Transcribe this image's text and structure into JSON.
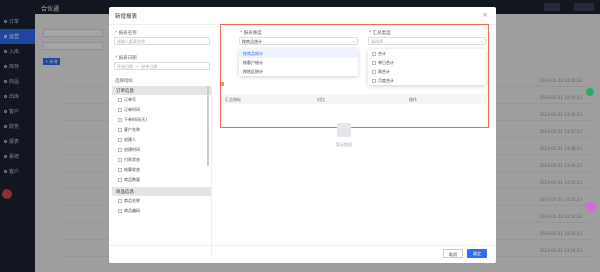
{
  "app": {
    "title": "合伙通"
  },
  "sidebar": {
    "items": [
      {
        "label": "订单"
      },
      {
        "label": "运营"
      },
      {
        "label": "入库"
      },
      {
        "label": "库存"
      },
      {
        "label": "商品"
      },
      {
        "label": "出库"
      },
      {
        "label": "客户"
      },
      {
        "label": "财务"
      },
      {
        "label": "报表"
      },
      {
        "label": "系统"
      },
      {
        "label": "客户"
      }
    ],
    "active_index": 1
  },
  "background": {
    "label_a": "日期",
    "label_b": "名称",
    "add_button": "+ 新增",
    "timestamps": [
      "2023-05-31 14:40:23",
      "2023-05-31 14:45:23",
      "2023-05-31 14:46:23",
      "2023-05-31 14:47:23",
      "2023-05-31 14:48:23",
      "2023-05-31 14:49:23",
      "2023-05-31 14:50:23",
      "2023-05-31 14:51:23",
      "2023-05-31 14:52:23",
      "2023-05-31 14:53:23",
      "2023-05-31 14:54:23"
    ]
  },
  "modal": {
    "title": "新增报表",
    "field1_label": "报表名称",
    "field1_placeholder": "请输入报表名称",
    "field2_label": "报表日期",
    "date_start": "开始日期",
    "date_end": "结束日期",
    "tree_title": "选择指标",
    "tree": [
      {
        "group": "订单信息",
        "leaves": [
          "订单号",
          "订单时间",
          "下单时间(天)",
          "客户名称",
          "创建人",
          "创建时间",
          "付款状态",
          "结算状态",
          "商品数量"
        ]
      },
      {
        "group": "商品信息",
        "leaves": [
          "商品名称",
          "商品编码"
        ]
      }
    ],
    "select1_label": "报表维度",
    "select1_value": "按商品统计",
    "select1_options": [
      "按商品统计",
      "按客户统计",
      "按地区统计"
    ],
    "select2_label": "汇总类型",
    "select2_value": "请选择",
    "select2_options": [
      "合计",
      "单日合计",
      "周合计",
      "月度合计"
    ],
    "table_headers": [
      "汇总指标",
      "对比",
      "操作"
    ],
    "empty_text": "暂无数据",
    "cancel": "取消",
    "ok": "确定"
  }
}
